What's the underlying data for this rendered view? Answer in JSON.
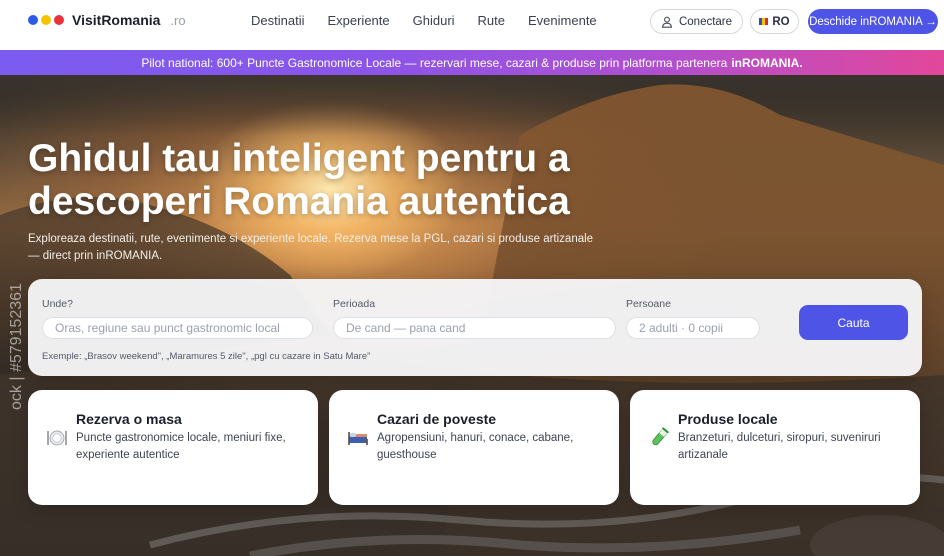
{
  "header": {
    "logo_name": "VisitRomania",
    "logo_tld": ".ro",
    "logo_dot_colors": [
      "#2d5be3",
      "#f5c400",
      "#e8333c"
    ],
    "nav": [
      "Destinatii",
      "Experiente",
      "Ghiduri",
      "Rute",
      "Evenimente"
    ],
    "login_label": "Conectare",
    "login_icon": "user-icon",
    "lang_label": "RO",
    "lang_icon": "romania-flag-icon",
    "cta_label": "Deschide inROMANIA →",
    "accent_color": "#4e55e6"
  },
  "banner": {
    "text": "Pilot national: 600+ Puncte Gastronomice Locale — rezervari mese, cazari & produse prin platforma partenera",
    "brand": "inROMANIA."
  },
  "hero": {
    "title": "Ghidul tau inteligent pentru a descoperi Romania autentica",
    "subtitle": "Exploreaza destinatii, rute, evenimente si experiente locale. Rezerva mese la PGL, cazari si produse artizanale — direct prin inROMANIA.",
    "watermark": "ock | #579152361"
  },
  "search": {
    "where_label": "Unde?",
    "where_placeholder": "Oras, regiune sau punct gastronomic local",
    "period_label": "Perioada",
    "period_placeholder": "De cand — pana cand",
    "people_label": "Persoane",
    "people_placeholder": "2 adulti · 0 copii",
    "button_label": "Cauta",
    "examples": "Exemple: „Brasov weekend\", „Maramures 5 zile\", „pgl cu cazare in Satu Mare\""
  },
  "cards": [
    {
      "icon": "plate-cutlery-icon",
      "title": "Rezerva o masa",
      "description": "Puncte gastronomice locale, meniuri fixe, experiente autentice"
    },
    {
      "icon": "bed-icon",
      "title": "Cazari de poveste",
      "description": "Agropensiuni, hanuri, conace, cabane, guesthouse"
    },
    {
      "icon": "test-tube-icon",
      "title": "Produse locale",
      "description": "Branzeturi, dulceturi, siropuri, suveniruri artizanale"
    }
  ]
}
